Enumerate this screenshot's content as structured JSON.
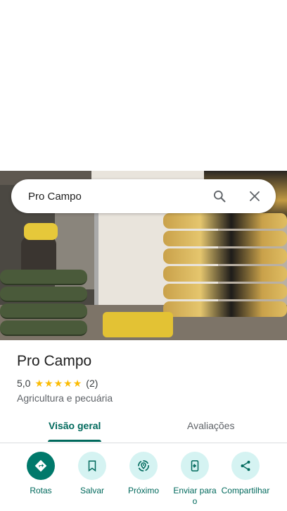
{
  "search": {
    "query": "Pro Campo"
  },
  "place": {
    "name": "Pro Campo",
    "rating": "5,0",
    "reviews": "(2)",
    "stars": 5,
    "category": "Agricultura e pecuária"
  },
  "tabs": [
    {
      "label": "Visão geral",
      "active": true
    },
    {
      "label": "Avaliações",
      "active": false
    }
  ],
  "actions": [
    {
      "label": "Rotas",
      "icon": "directions-icon"
    },
    {
      "label": "Salvar",
      "icon": "bookmark-icon"
    },
    {
      "label": "Próximo",
      "icon": "nearby-icon"
    },
    {
      "label": "Enviar para o",
      "icon": "send-to-phone-icon"
    },
    {
      "label": "Compartilhar",
      "icon": "share-icon"
    }
  ],
  "colors": {
    "accent": "#00695c",
    "action_bg": "#d5f3f2",
    "star": "#fbbc04"
  }
}
